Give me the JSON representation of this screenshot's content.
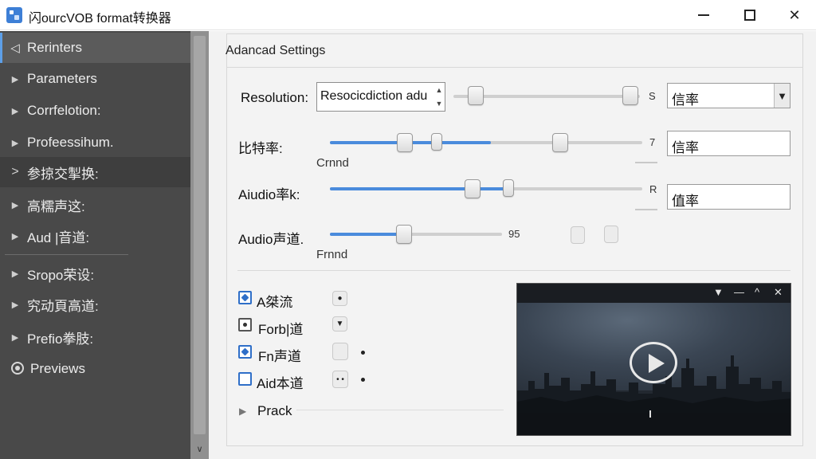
{
  "window": {
    "title": "闪ourcVOB format转换器",
    "minimize_icon": "minimize-icon",
    "maximize_icon": "maximize-icon",
    "close_icon": "close-icon",
    "close_glyph": "✕"
  },
  "sidebar": {
    "items": [
      {
        "label": "Rerinters",
        "icon": "chevron-left-icon",
        "glyph": "◁"
      },
      {
        "label": "Parameters",
        "icon": "chevron-right-icon",
        "glyph": "▶"
      },
      {
        "label": "Corrfelotion:",
        "icon": "chevron-right-icon",
        "glyph": "▶"
      },
      {
        "label": "Profeessihum.",
        "icon": "chevron-right-icon",
        "glyph": "▶"
      },
      {
        "label": "参掠交掣换:",
        "icon": "chevron-right-icon",
        "glyph": ">"
      },
      {
        "label": "高糯声这:",
        "icon": "chevron-right-icon",
        "glyph": "▶"
      },
      {
        "label": "Aud |音道:",
        "icon": "chevron-right-icon",
        "glyph": "▶"
      },
      {
        "label": "Sropo荣设:",
        "icon": "chevron-right-icon",
        "glyph": "▶"
      },
      {
        "label": "究动頁高道:",
        "icon": "chevron-right-icon",
        "glyph": "▶"
      },
      {
        "label": "Prefio拳肢:",
        "icon": "chevron-right-icon",
        "glyph": "▶"
      },
      {
        "label": "Previews",
        "icon": "preview-icon",
        "glyph": ""
      }
    ],
    "scroll_down_glyph": "∨"
  },
  "settings": {
    "title": "Adancad Settings",
    "resolution": {
      "label": "Resolution:",
      "input_value": "Resocicdiction adu",
      "spin_up": "▲",
      "spin_down": "▼",
      "slider_value": "S",
      "combo_value": "信率",
      "combo_arrow": "▼"
    },
    "bitrate": {
      "label": "比特率:",
      "sub_label": "Crnnd",
      "slider_value": "7",
      "field_value": "信率"
    },
    "audio_bitrate": {
      "label": "Aiudio率k:",
      "slider_value": "R",
      "field_value": "值率"
    },
    "audio_channel": {
      "label": "Audio声道.",
      "sub_label": "Frnnd",
      "slider_value": "95"
    }
  },
  "options": [
    {
      "label": "A桀流",
      "checked": true,
      "style": "blue"
    },
    {
      "label": "Forb|道",
      "checked": true,
      "style": "grey"
    },
    {
      "label": "Fn声道",
      "checked": true,
      "style": "blue"
    },
    {
      "label": "Aid本道",
      "checked": false,
      "style": "blue"
    }
  ],
  "option_controls": {
    "row1_glyph": "●",
    "row2_glyph": "▼",
    "row4_glyph": "• •"
  },
  "prack": {
    "label": "Prack",
    "play_glyph": "▶"
  },
  "video": {
    "controls": [
      "▼",
      "—",
      "^",
      "✕"
    ],
    "play_icon": "play-icon"
  }
}
